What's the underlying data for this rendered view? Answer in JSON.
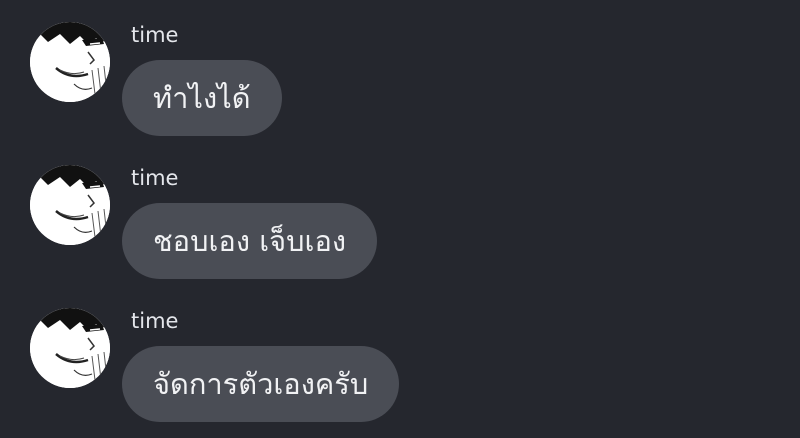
{
  "theme": {
    "background": "#25272e",
    "bubble": "#4a4d55",
    "text": "#f1f2f4",
    "sender_text": "#e4e6eb"
  },
  "messages": [
    {
      "sender": "time",
      "avatar_icon": "manga-face-avatar",
      "text": "ทำไงได้"
    },
    {
      "sender": "time",
      "avatar_icon": "manga-face-avatar",
      "text": "ชอบเอง เจ็บเอง"
    },
    {
      "sender": "time",
      "avatar_icon": "manga-face-avatar",
      "text": "จัดการตัวเองครับ"
    }
  ]
}
